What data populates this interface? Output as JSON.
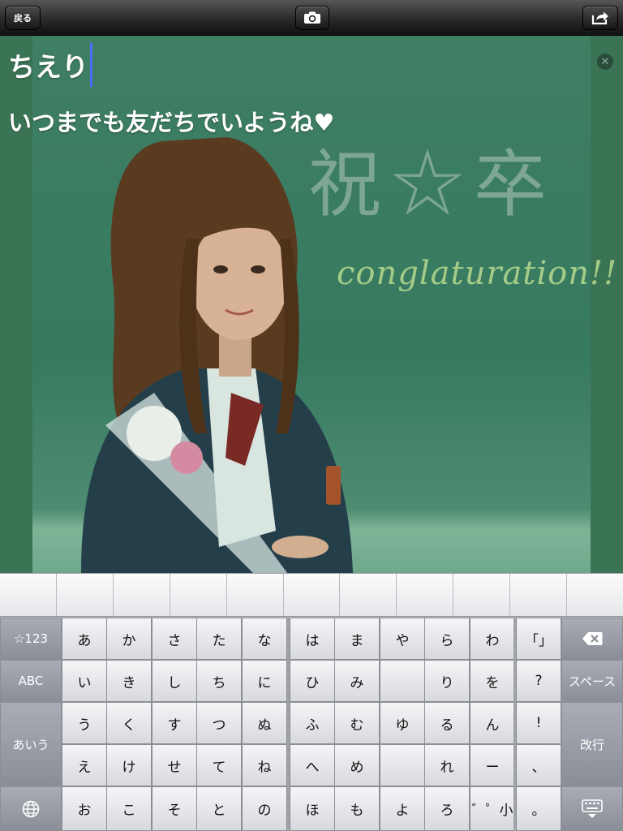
{
  "toolbar": {
    "back_label": "戻る",
    "camera_icon": "camera-icon",
    "share_icon": "share-icon"
  },
  "editor": {
    "title_text": "ちえり",
    "message_text": "いつまでも友だちでいようね♥",
    "clear_icon": "clear-icon"
  },
  "photo": {
    "chalk_kanji": "祝☆卒",
    "chalk_text": "conglaturation!!",
    "accent_color": "#3c7a5c"
  },
  "keyboard": {
    "left_keys": [
      "☆123",
      "ABC",
      "あいう"
    ],
    "globe_icon": "globe-icon",
    "kana_columns": [
      [
        "あ",
        "い",
        "う",
        "え",
        "お"
      ],
      [
        "か",
        "き",
        "く",
        "け",
        "こ"
      ],
      [
        "さ",
        "し",
        "す",
        "せ",
        "そ"
      ],
      [
        "た",
        "ち",
        "つ",
        "て",
        "と"
      ],
      [
        "な",
        "に",
        "ぬ",
        "ね",
        "の"
      ],
      [
        "は",
        "ひ",
        "ふ",
        "へ",
        "ほ"
      ],
      [
        "ま",
        "み",
        "む",
        "め",
        "も"
      ],
      [
        "や",
        "",
        "ゆ",
        "",
        "よ"
      ],
      [
        "ら",
        "り",
        "る",
        "れ",
        "ろ"
      ],
      [
        "わ",
        "を",
        "ん",
        "ー",
        "゛゜小"
      ]
    ],
    "punct_column": [
      "「」",
      "?",
      "!",
      "、",
      "。"
    ],
    "right_keys": {
      "delete_icon": "backspace-icon",
      "space_label": "スペース",
      "return_label": "改行",
      "dismiss_icon": "keyboard-dismiss-icon"
    }
  }
}
